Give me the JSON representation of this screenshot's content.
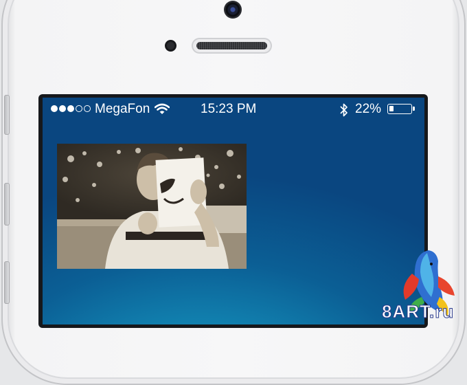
{
  "status_bar": {
    "signal": {
      "filled": 3,
      "total": 5
    },
    "carrier": "MegaFon",
    "time": "15:23 PM",
    "battery_percent": "22%",
    "battery_level": 0.22,
    "icons": [
      "signal-dots-icon",
      "wifi-icon",
      "bluetooth-icon",
      "battery-icon"
    ]
  },
  "photo": {
    "subject": "photo-thumbnail"
  },
  "watermark": {
    "text": "8ART.ru"
  },
  "colors": {
    "screen_top": "#0a4680",
    "screen_glow": "#1fa3c3",
    "phone_body": "#f4f4f5",
    "bezel": "#16181c"
  }
}
